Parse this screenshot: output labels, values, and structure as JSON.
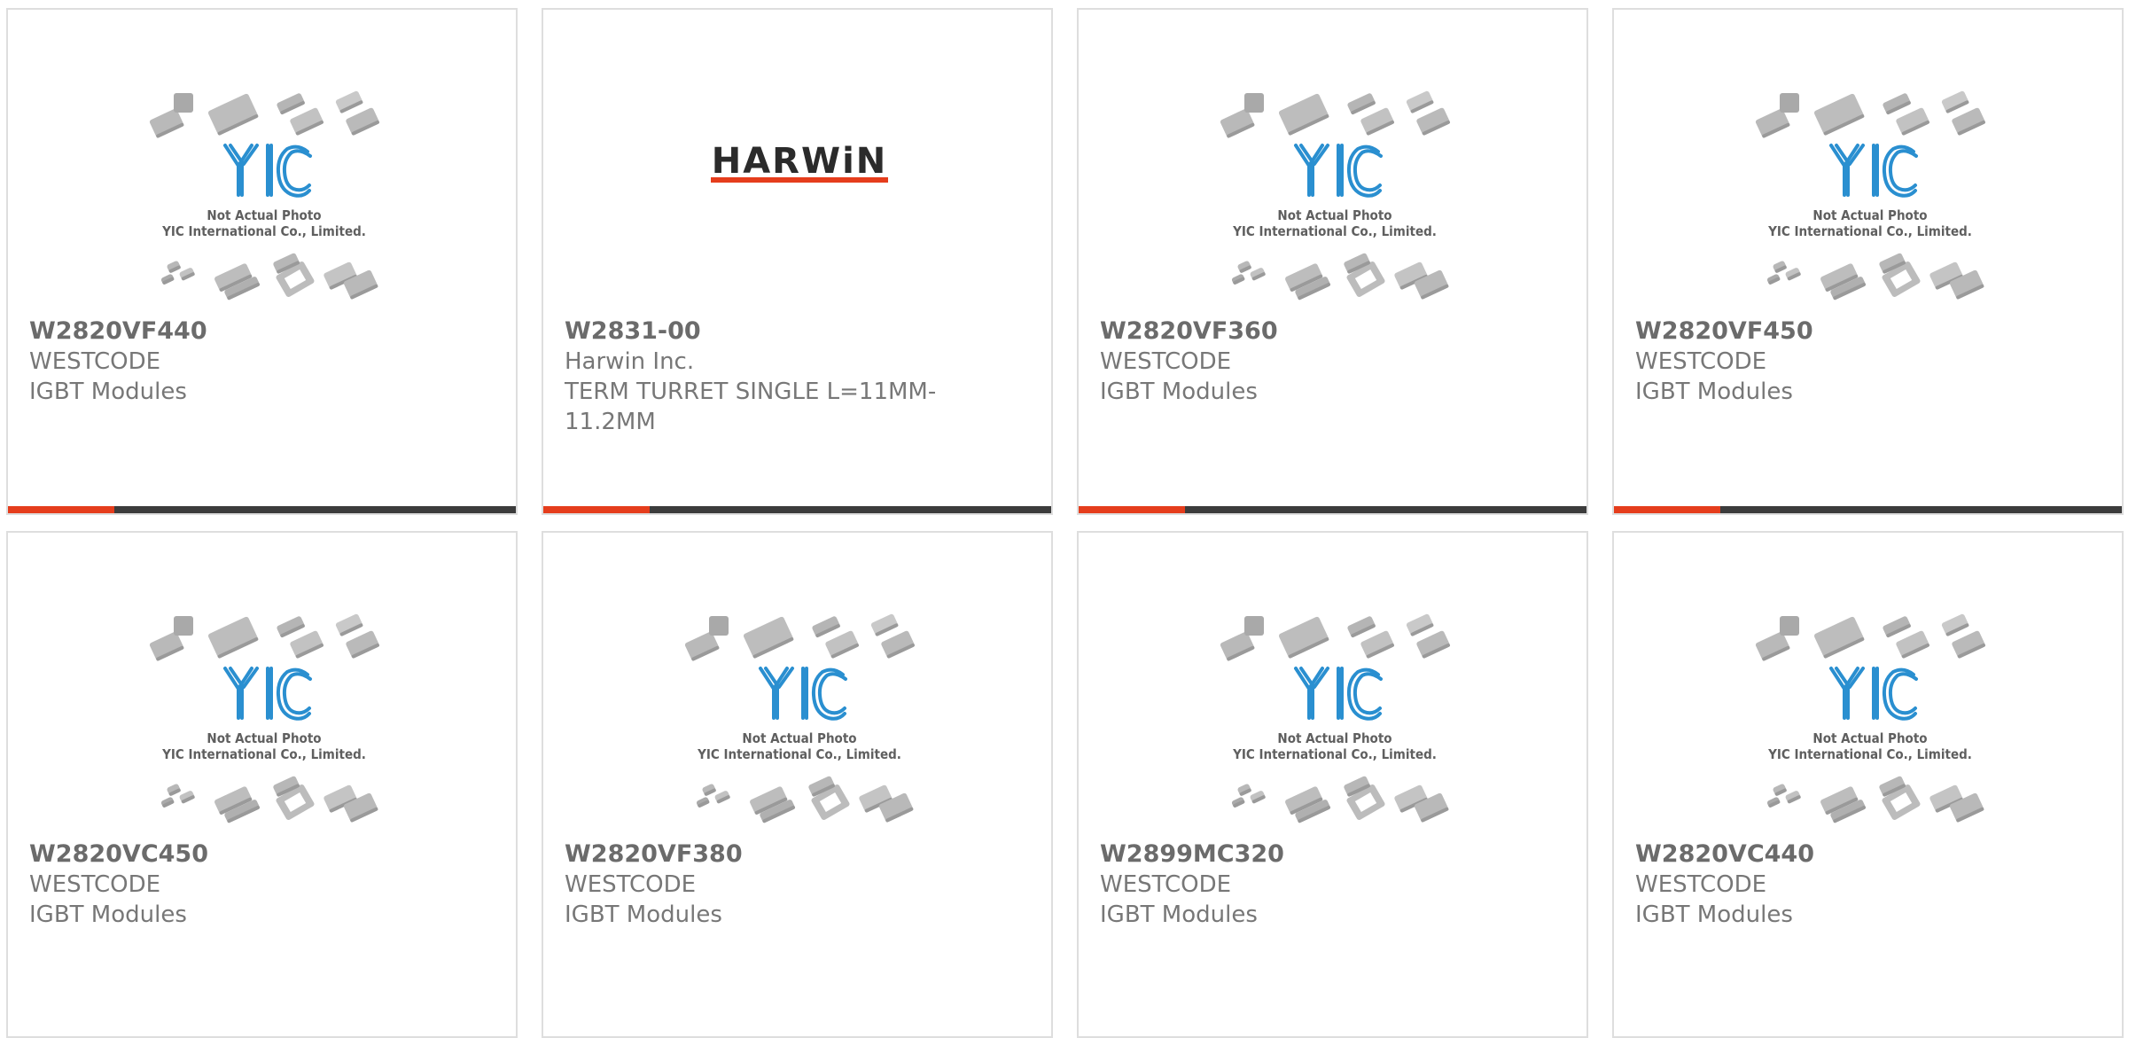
{
  "placeholder": {
    "line1": "Not Actual Photo",
    "line2": "YIC International Co., Limited.",
    "logo_text": "YIC"
  },
  "harwin_logo": "HARWiN",
  "colors": {
    "accent": "#e53d1c",
    "bar_dark": "#3c3c3c",
    "yic_blue": "#2a8fd0"
  },
  "products": [
    {
      "part": "W2820VF440",
      "maker": "WESTCODE",
      "desc": "IGBT Modules",
      "image": "yic-placeholder"
    },
    {
      "part": "W2831-00",
      "maker": "Harwin Inc.",
      "desc": "TERM TURRET SINGLE L=11MM-11.2MM",
      "image": "harwin-logo"
    },
    {
      "part": "W2820VF360",
      "maker": "WESTCODE",
      "desc": "IGBT Modules",
      "image": "yic-placeholder"
    },
    {
      "part": "W2820VF450",
      "maker": "WESTCODE",
      "desc": "IGBT Modules",
      "image": "yic-placeholder"
    },
    {
      "part": "W2820VC450",
      "maker": "WESTCODE",
      "desc": "IGBT Modules",
      "image": "yic-placeholder"
    },
    {
      "part": "W2820VF380",
      "maker": "WESTCODE",
      "desc": "IGBT Modules",
      "image": "yic-placeholder"
    },
    {
      "part": "W2899MC320",
      "maker": "WESTCODE",
      "desc": "IGBT Modules",
      "image": "yic-placeholder"
    },
    {
      "part": "W2820VC440",
      "maker": "WESTCODE",
      "desc": "IGBT Modules",
      "image": "yic-placeholder"
    }
  ],
  "card_bar_progress": 0.21
}
